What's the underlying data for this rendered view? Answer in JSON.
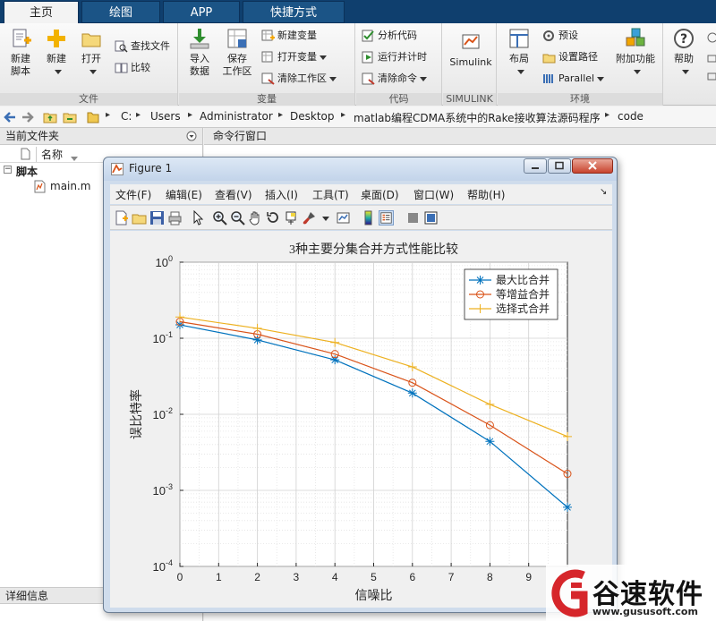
{
  "ribbon_tabs": [
    {
      "label": "主页",
      "active": true
    },
    {
      "label": "绘图",
      "active": false
    },
    {
      "label": "APP",
      "active": false
    },
    {
      "label": "快捷方式",
      "active": false
    }
  ],
  "ribbon": {
    "file": {
      "label": "文件",
      "new_script": "新建\n脚本",
      "new_script_l1": "新建",
      "new_script_l2": "脚本",
      "new": "新建",
      "open": "打开",
      "find_files": "查找文件",
      "compare": "比较"
    },
    "variable": {
      "label": "变量",
      "import_l1": "导入",
      "import_l2": "数据",
      "save_l1": "保存",
      "save_l2": "工作区",
      "new_variable": "新建变量",
      "open_variable": "打开变量",
      "clear_workspace": "清除工作区"
    },
    "code": {
      "label": "代码",
      "analyze": "分析代码",
      "run_time": "运行并计时",
      "clear_commands": "清除命令"
    },
    "simulink": {
      "label": "SIMULINK",
      "simulink": "Simulink"
    },
    "environment": {
      "label": "环境",
      "layout": "布局",
      "preferences": "预设",
      "set_path": "设置路径",
      "parallel": "Parallel",
      "addons": "附加功能"
    },
    "help": {
      "help": "帮助"
    }
  },
  "address": {
    "crumbs": [
      "C:",
      "Administrator",
      "Desktop",
      "matlab编程CDMA系统中的Rake接收算法源码程序",
      "code"
    ],
    "users": "Users"
  },
  "current_folder": {
    "title": "当前文件夹",
    "col_name": "名称",
    "group": "脚本",
    "file": "main.m",
    "details": "详细信息"
  },
  "command_window": {
    "title": "命令行窗口"
  },
  "figure": {
    "title": "Figure 1",
    "menus": [
      "文件(F)",
      "编辑(E)",
      "查看(V)",
      "插入(I)",
      "工具(T)",
      "桌面(D)",
      "窗口(W)",
      "帮助(H)"
    ]
  },
  "watermark": {
    "brand": "谷速软件",
    "url": "www.gususoft.com"
  },
  "chart_data": {
    "type": "line",
    "title": "3种主要分集合并方式性能比较",
    "xlabel": "信噪比",
    "ylabel": "误比特率",
    "yscale": "log",
    "xlim": [
      0,
      10
    ],
    "ylim": [
      0.0001,
      1
    ],
    "xticks": [
      0,
      1,
      2,
      3,
      4,
      5,
      6,
      7,
      8,
      9
    ],
    "yticks": [
      "10^0",
      "10^-1",
      "10^-2",
      "10^-3",
      "10^-4"
    ],
    "grid": true,
    "legend_position": "top-right",
    "x": [
      0,
      2,
      4,
      6,
      8,
      10
    ],
    "series": [
      {
        "name": "最大比合并",
        "color": "#0072bd",
        "marker": "star",
        "values": [
          0.15,
          0.095,
          0.052,
          0.019,
          0.0044,
          0.0006
        ]
      },
      {
        "name": "等增益合并",
        "color": "#d95319",
        "marker": "circle",
        "values": [
          0.165,
          0.113,
          0.062,
          0.026,
          0.0072,
          0.00165
        ]
      },
      {
        "name": "选择式合并",
        "color": "#edb120",
        "marker": "plus",
        "values": [
          0.19,
          0.135,
          0.088,
          0.042,
          0.0135,
          0.0051
        ]
      }
    ]
  }
}
